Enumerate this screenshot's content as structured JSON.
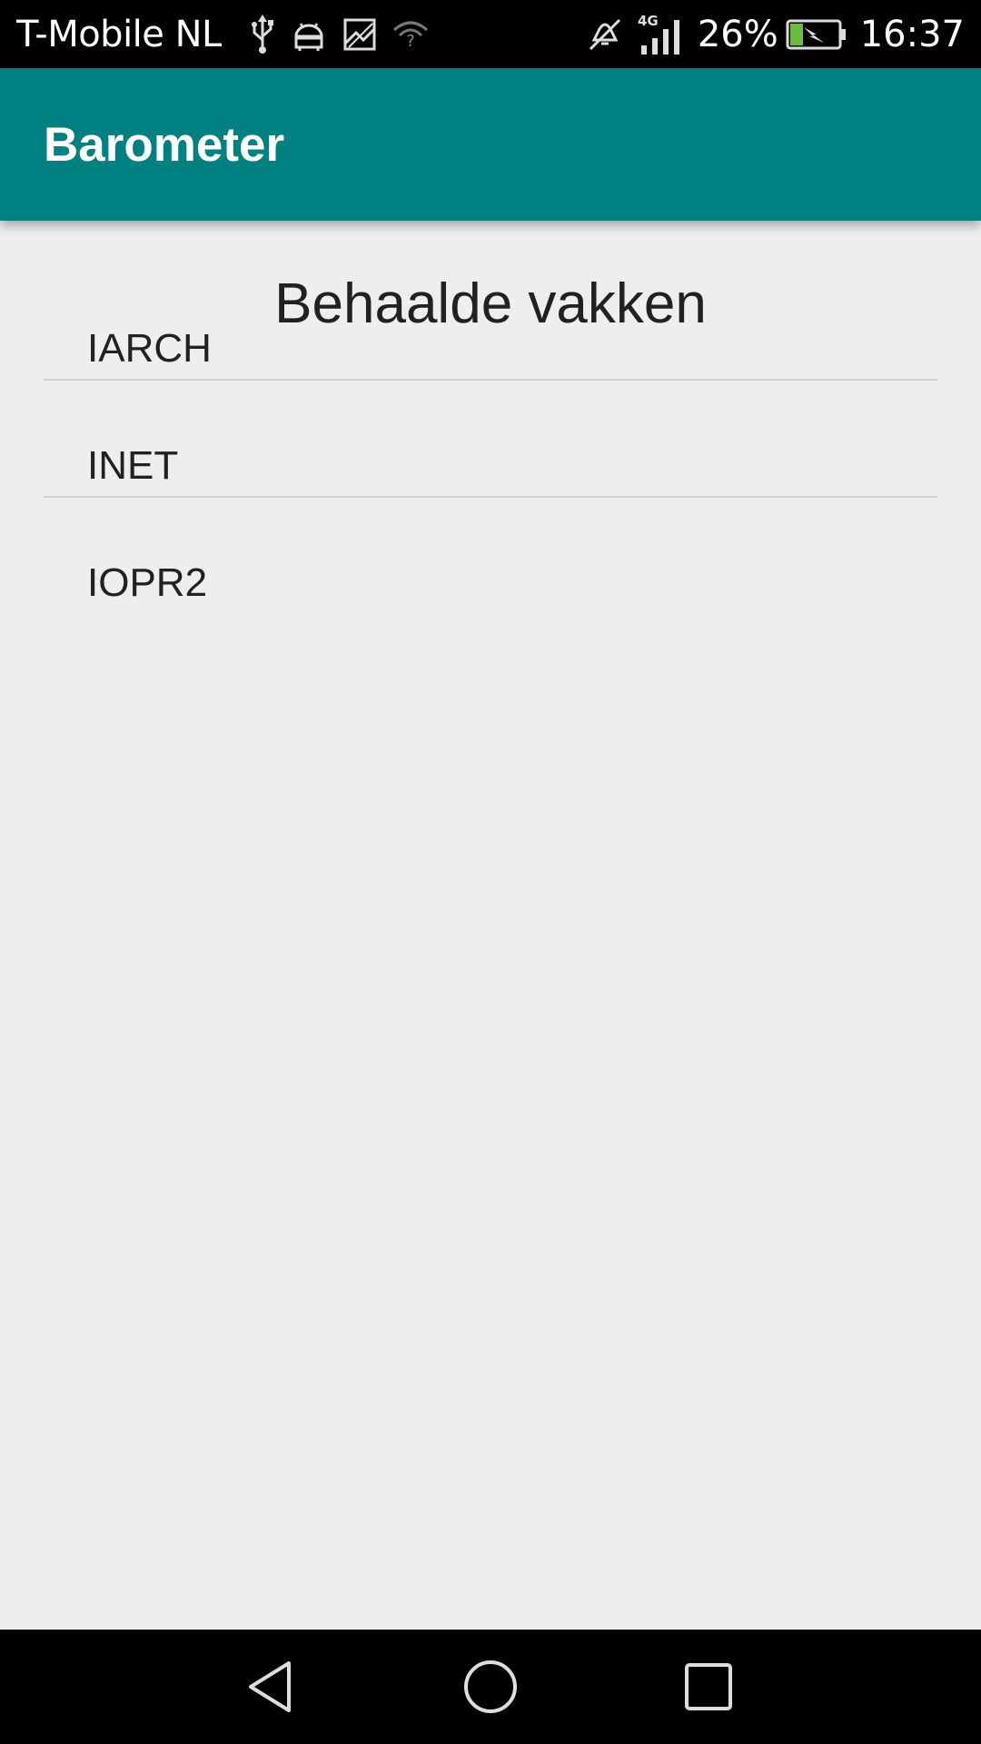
{
  "status_bar": {
    "carrier": "T-Mobile  NL",
    "left_icons": [
      "usb-icon",
      "android-debug-icon",
      "image-icon",
      "wifi-unknown-icon"
    ],
    "right_icons": [
      "mute-icon",
      "signal-4g-icon",
      "battery-charging-icon"
    ],
    "network_label": "4G",
    "battery_percent": "26%",
    "battery_level": 0.26,
    "time": "16:37"
  },
  "app_bar": {
    "title": "Barometer",
    "color": "#008080"
  },
  "content": {
    "heading": "Behaalde vakken",
    "items": [
      {
        "label": "IARCH"
      },
      {
        "label": "INET"
      },
      {
        "label": "IOPR2"
      }
    ]
  },
  "nav_bar": {
    "buttons": [
      "back-icon",
      "home-icon",
      "recents-icon"
    ]
  },
  "colors": {
    "primary": "#008080",
    "background": "#EEEEEE",
    "text": "#212121",
    "divider": "#CFCFCF",
    "battery_fill": "#6DBB3F"
  }
}
